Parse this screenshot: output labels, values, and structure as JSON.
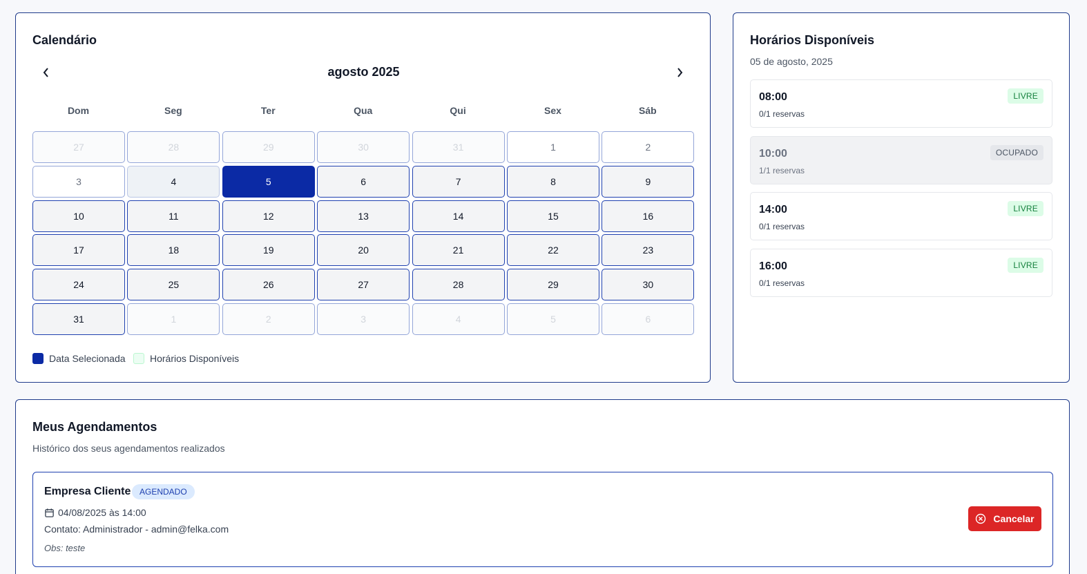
{
  "calendar": {
    "title": "Calendário",
    "month_label": "agosto 2025",
    "prev_icon": "chevron-left-icon",
    "next_icon": "chevron-right-icon",
    "weekdays": [
      "Dom",
      "Seg",
      "Ter",
      "Qua",
      "Qui",
      "Sex",
      "Sáb"
    ],
    "weeks": [
      [
        {
          "d": "27",
          "s": "outside"
        },
        {
          "d": "28",
          "s": "outside"
        },
        {
          "d": "29",
          "s": "outside"
        },
        {
          "d": "30",
          "s": "outside"
        },
        {
          "d": "31",
          "s": "outside"
        },
        {
          "d": "1",
          "s": "past"
        },
        {
          "d": "2",
          "s": "past"
        }
      ],
      [
        {
          "d": "3",
          "s": "past"
        },
        {
          "d": "4",
          "s": "past-soft"
        },
        {
          "d": "5",
          "s": "selected"
        },
        {
          "d": "6",
          "s": "available"
        },
        {
          "d": "7",
          "s": "available"
        },
        {
          "d": "8",
          "s": "available"
        },
        {
          "d": "9",
          "s": "available"
        }
      ],
      [
        {
          "d": "10",
          "s": "available"
        },
        {
          "d": "11",
          "s": "available"
        },
        {
          "d": "12",
          "s": "available"
        },
        {
          "d": "13",
          "s": "available"
        },
        {
          "d": "14",
          "s": "available"
        },
        {
          "d": "15",
          "s": "available"
        },
        {
          "d": "16",
          "s": "available"
        }
      ],
      [
        {
          "d": "17",
          "s": "available"
        },
        {
          "d": "18",
          "s": "available"
        },
        {
          "d": "19",
          "s": "available"
        },
        {
          "d": "20",
          "s": "available"
        },
        {
          "d": "21",
          "s": "available"
        },
        {
          "d": "22",
          "s": "available"
        },
        {
          "d": "23",
          "s": "available"
        }
      ],
      [
        {
          "d": "24",
          "s": "available"
        },
        {
          "d": "25",
          "s": "available"
        },
        {
          "d": "26",
          "s": "available"
        },
        {
          "d": "27",
          "s": "available"
        },
        {
          "d": "28",
          "s": "available"
        },
        {
          "d": "29",
          "s": "available"
        },
        {
          "d": "30",
          "s": "available"
        }
      ],
      [
        {
          "d": "31",
          "s": "available"
        },
        {
          "d": "1",
          "s": "outside"
        },
        {
          "d": "2",
          "s": "outside"
        },
        {
          "d": "3",
          "s": "outside"
        },
        {
          "d": "4",
          "s": "outside"
        },
        {
          "d": "5",
          "s": "outside"
        },
        {
          "d": "6",
          "s": "outside"
        }
      ]
    ],
    "legend": [
      {
        "label": "Data Selecionada",
        "color": "#0b2aa5",
        "border": "#0b2aa5"
      },
      {
        "label": "Horários Disponíveis",
        "color": "#ecfdf3",
        "border": "#bbf7d0"
      }
    ]
  },
  "slots": {
    "title": "Horários Disponíveis",
    "date_label": "05 de agosto, 2025",
    "items": [
      {
        "time": "08:00",
        "count": "0/1 reservas",
        "status": "LIVRE",
        "busy": false
      },
      {
        "time": "10:00",
        "count": "1/1 reservas",
        "status": "OCUPADO",
        "busy": true
      },
      {
        "time": "14:00",
        "count": "0/1 reservas",
        "status": "LIVRE",
        "busy": false
      },
      {
        "time": "16:00",
        "count": "0/1 reservas",
        "status": "LIVRE",
        "busy": false
      }
    ]
  },
  "appointments": {
    "title": "Meus Agendamentos",
    "subtitle": "Histórico dos seus agendamentos realizados",
    "items": [
      {
        "company": "Empresa Cliente",
        "status": "AGENDADO",
        "date_icon": "calendar-icon",
        "datetime": "04/08/2025 às 14:00",
        "contact": "Contato: Administrador - admin@felka.com",
        "obs": "Obs: teste",
        "cancel_label": "Cancelar",
        "cancel_icon": "x-circle-icon"
      }
    ]
  },
  "colors": {
    "accent": "#0b2aa5",
    "border": "#1e40af",
    "danger": "#dc2626",
    "free_bg": "#dcfce7",
    "free_text": "#15803d"
  }
}
